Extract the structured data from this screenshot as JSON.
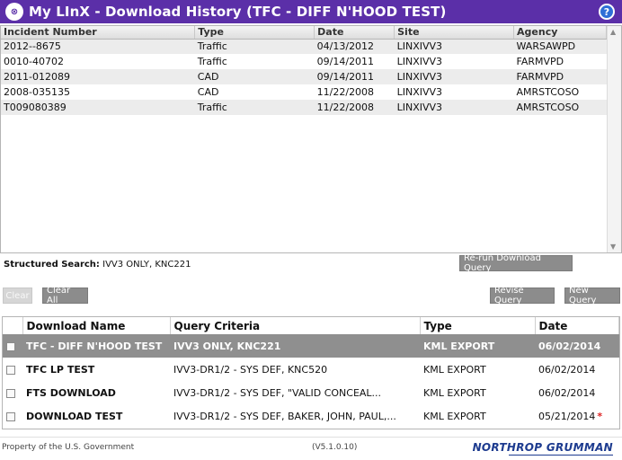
{
  "window": {
    "title": "My LInX - Download History (TFC - DIFF N'HOOD TEST)",
    "logo_icon": "linx-logo-icon",
    "help_icon": "help-icon",
    "accent_color": "#5b2fa8"
  },
  "incidents": {
    "headers": [
      "Incident Number",
      "Type",
      "Date",
      "Site",
      "Agency"
    ],
    "rows": [
      [
        "2012--8675",
        "Traffic",
        "04/13/2012",
        "LINXIVV3",
        "WARSAWPD"
      ],
      [
        "0010-40702",
        "Traffic",
        "09/14/2011",
        "LINXIVV3",
        "FARMVPD"
      ],
      [
        "2011-012089",
        "CAD",
        "09/14/2011",
        "LINXIVV3",
        "FARMVPD"
      ],
      [
        "2008-035135",
        "CAD",
        "11/22/2008",
        "LINXIVV3",
        "AMRSTCOSO"
      ],
      [
        "T009080389",
        "Traffic",
        "11/22/2008",
        "LINXIVV3",
        "AMRSTCOSO"
      ]
    ]
  },
  "structured_search": {
    "label": "Structured Search:",
    "value": "IVV3 ONLY, KNC221"
  },
  "buttons": {
    "rerun": "Re-run Download Query",
    "clear": "Clear",
    "clear_all": "Clear All",
    "revise": "Revise Query",
    "new_query": "New Query"
  },
  "downloads": {
    "headers": [
      "Download Name",
      "Query Criteria",
      "Type",
      "Date"
    ],
    "rows": [
      {
        "name": "TFC - DIFF N'HOOD TEST",
        "criteria": "IVV3 ONLY, KNC221",
        "type": "KML EXPORT",
        "date": "06/02/2014",
        "selected": true,
        "flag": ""
      },
      {
        "name": "TFC LP TEST",
        "criteria": "IVV3-DR1/2 - SYS DEF, KNC520",
        "type": "KML EXPORT",
        "date": "06/02/2014",
        "selected": false,
        "flag": ""
      },
      {
        "name": "FTS DOWNLOAD",
        "criteria": "IVV3-DR1/2 - SYS DEF, \"VALID CONCEAL...",
        "type": "KML EXPORT",
        "date": "06/02/2014",
        "selected": false,
        "flag": ""
      },
      {
        "name": "DOWNLOAD TEST",
        "criteria": "IVV3-DR1/2 - SYS DEF, BAKER, JOHN, PAUL,...",
        "type": "KML EXPORT",
        "date": "05/21/2014",
        "selected": false,
        "flag": "*"
      }
    ]
  },
  "footer": {
    "left": "Property of the U.S. Government",
    "version": "(V5.1.0.10)",
    "brand": "NORTHROP GRUMMAN"
  }
}
